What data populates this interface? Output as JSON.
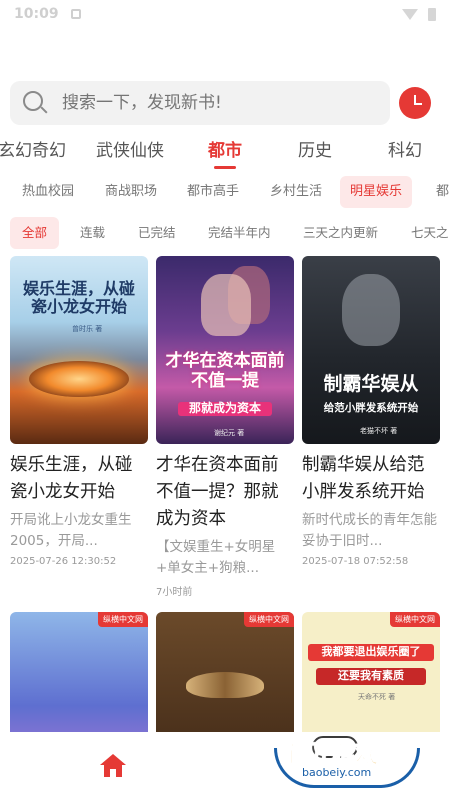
{
  "status_bar": {
    "time": "10:09"
  },
  "search": {
    "placeholder": "搜索一下，发现新书!"
  },
  "categories": [
    "玄幻奇幻",
    "武侠仙侠",
    "都市",
    "历史",
    "科幻"
  ],
  "sub_categories": [
    "热血校园",
    "商战职场",
    "都市高手",
    "乡村生活",
    "明星娱乐",
    "都"
  ],
  "filters": [
    "全部",
    "连载",
    "已完结",
    "完结半年内",
    "三天之内更新",
    "七天之"
  ],
  "books": [
    {
      "cover_text": "娱乐生涯，从碰瓷小龙女开始",
      "cover_author": "曾时乐 著",
      "title": "娱乐生涯，从碰瓷小龙女开始",
      "desc": "开局讹上小龙女重生2005，开局...",
      "time": "2025-07-26 12:30:52"
    },
    {
      "cover_text": "才华在资本面前不值一提",
      "cover_sub": "那就成为资本",
      "cover_author": "谢纪元 著",
      "title": "才华在资本面前不值一提？那就成为资本",
      "desc": "【文娱重生+女明星+单女主+狗粮...",
      "time": "7小时前"
    },
    {
      "cover_text": "制霸华娱从",
      "cover_sub": "给范小胖发系统开始",
      "cover_author": "老猫不坏 著",
      "title": "制霸华娱从给范小胖发系统开始",
      "desc": "新时代成长的青年怎能妥协于旧时...",
      "time": "2025-07-18 07:52:58"
    },
    {
      "badge": "纵横中文网"
    },
    {
      "badge": "纵横中文网"
    },
    {
      "badge": "纵横中文网",
      "cover_text": "我都要退出娱乐圈了",
      "cover_sub": "还要我有素质",
      "cover_author": "天命不死 著"
    }
  ],
  "watermark": {
    "text": "宝贝游戏网",
    "url": "baobeiy.com"
  },
  "colors": {
    "accent": "#e53935",
    "accent_bg": "#fde8e8"
  },
  "icons": [
    "search-icon",
    "history-clock-icon",
    "home-icon"
  ]
}
